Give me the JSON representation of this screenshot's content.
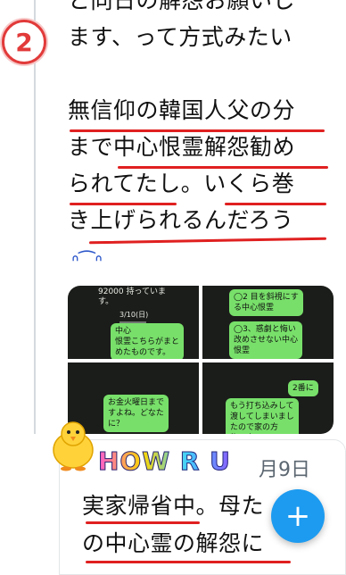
{
  "marker": {
    "number": "2"
  },
  "tweet1": {
    "lines": [
      "と同日の解怨お願いし",
      "ます、って方式みたい",
      "",
      "無信仰の韓国人父の分",
      "まで中心恨霊解怨勧め",
      "られてたし。いくら巻",
      "き上げられるんだろう"
    ],
    "emoji": "ᐢ⁀ᐢ"
  },
  "media": {
    "cell1": {
      "top_text": "92000 持っていま\nす。",
      "date": "3/10(日)",
      "bubble": "中心\n恨霊こちらがまと\nめたものです。"
    },
    "cell2": {
      "bubble1": "◯2 目を斜視にす\nる中心恨霊",
      "bubble2": "◯3、惑劇と悔い\n改めさせない中心\n恨霊"
    },
    "cell3": {
      "bubble": "お金火曜日まで\nすよね。どなた\nに？"
    },
    "cell4": {
      "bubble1": "2番に",
      "bubble2": "もう打ち込みして\n渡してしまいまし\nたので家の方\n物の方"
    }
  },
  "tweet2": {
    "date": "月9日",
    "sticker_text": "HOW R U",
    "lines": [
      "実家帰省中。母た",
      "の中心霊の解怨に"
    ]
  },
  "fab": {
    "label": "+"
  },
  "colors": {
    "accent": "#1d9bf0",
    "underline": "#e02020",
    "marker": "#e23a3a"
  }
}
